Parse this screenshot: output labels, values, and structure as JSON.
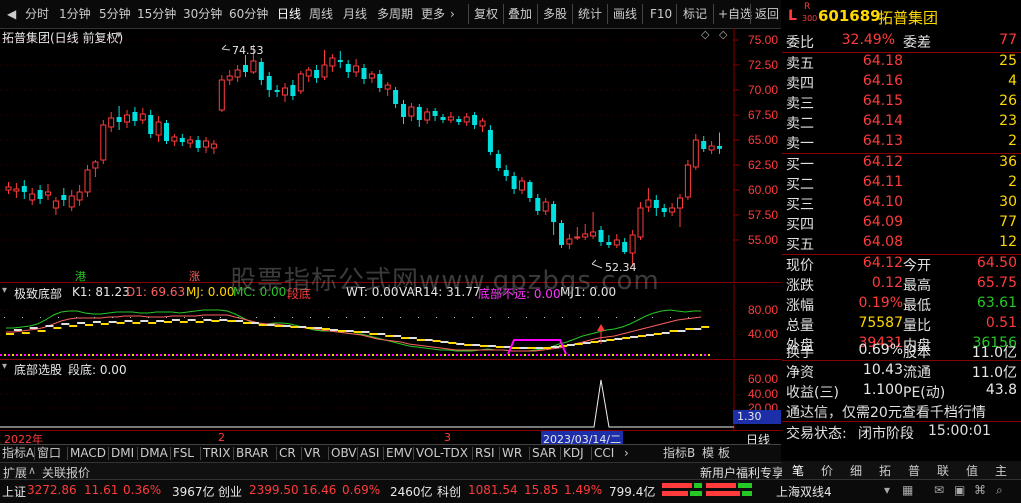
{
  "toolbar": {
    "items": [
      "分时",
      "1分钟",
      "5分钟",
      "15分钟",
      "30分钟",
      "60分钟",
      "日线",
      "周线",
      "月线",
      "多周期",
      "更多",
      "复权",
      "叠加",
      "多股",
      "统计",
      "画线",
      "F10",
      "标记",
      "+自选",
      "返回"
    ],
    "selected": "日线"
  },
  "stock": {
    "prefix": "L",
    "badge_r": "R",
    "badge_num": "300",
    "code": "601689",
    "name": "拓普集团"
  },
  "main_chart": {
    "title": "拓普集团(日线 前复权)",
    "marker_high": "74.53",
    "marker_low": "52.34",
    "marks": {
      "gang": "港",
      "zhang": "涨"
    },
    "y_ticks": [
      "75.00",
      "72.50",
      "70.00",
      "67.50",
      "65.00",
      "62.50",
      "60.00",
      "57.50",
      "55.00"
    ]
  },
  "sub1": {
    "name": "极致底部",
    "k1": "K1: 81.23",
    "d1": "D1: 69.63",
    "mj": "MJ: 0.00",
    "mc": "MC: 0.00",
    "duandi": "段底",
    "wt": "WT: 0.00",
    "var14": "VAR14: 31.77",
    "dibu": "底部不远: 0.00",
    "mj1": "MJ1: 0.00",
    "y_ticks": [
      "80.00",
      "40.00"
    ]
  },
  "sub2": {
    "name": "底部选股",
    "duandi": "段底: 0.00",
    "y_ticks": [
      "60.00",
      "40.00",
      "20.00"
    ],
    "cursor_value": "1.30"
  },
  "dates": {
    "year": "2022年",
    "m2": "2",
    "m3": "3",
    "cursor_date": "2023/03/14/二",
    "period": "日线"
  },
  "quote": {
    "weibi_label": "委比",
    "weibi": "32.49%",
    "weicha_label": "委差",
    "weicha": "77",
    "asks": [
      {
        "label": "卖五",
        "price": "64.18",
        "vol": "25"
      },
      {
        "label": "卖四",
        "price": "64.16",
        "vol": "4"
      },
      {
        "label": "卖三",
        "price": "64.15",
        "vol": "26"
      },
      {
        "label": "卖二",
        "price": "64.14",
        "vol": "23"
      },
      {
        "label": "卖一",
        "price": "64.13",
        "vol": "2"
      }
    ],
    "bids": [
      {
        "label": "买一",
        "price": "64.12",
        "vol": "36"
      },
      {
        "label": "买二",
        "price": "64.11",
        "vol": "2"
      },
      {
        "label": "买三",
        "price": "64.10",
        "vol": "30"
      },
      {
        "label": "买四",
        "price": "64.09",
        "vol": "77"
      },
      {
        "label": "买五",
        "price": "64.08",
        "vol": "12"
      }
    ],
    "stats": [
      {
        "l1": "现价",
        "v1": "64.12",
        "l2": "今开",
        "v2": "64.50"
      },
      {
        "l1": "涨跌",
        "v1": "0.12",
        "l2": "最高",
        "v2": "65.75"
      },
      {
        "l1": "涨幅",
        "v1": "0.19%",
        "l2": "最低",
        "v2": "63.61"
      },
      {
        "l1": "总量",
        "v1": "75587",
        "l2": "量比",
        "v2": "0.51"
      },
      {
        "l1": "外盘",
        "v1": "39431",
        "l2": "内盘",
        "v2": "36156"
      }
    ],
    "stats2": [
      {
        "l1": "换手",
        "v1": "0.69%",
        "l2": "股本",
        "v2": "11.0亿"
      },
      {
        "l1": "净资",
        "v1": "10.43",
        "l2": "流通",
        "v2": "11.0亿"
      },
      {
        "l1": "收益(三)",
        "v1": "1.100",
        "l2": "PE(动)",
        "v2": "43.8"
      }
    ],
    "ad_text": "通达信，仅需20元查看千档行情",
    "trade_status_label": "交易状态:",
    "trade_status": "闭市阶段",
    "trade_time": "15:00:01"
  },
  "tabs": [
    "指标A",
    "窗口",
    "MACD",
    "DMI",
    "DMA",
    "FSL",
    "TRIX",
    "BRAR",
    "CR",
    "VR",
    "OBV",
    "ASI",
    "EMV",
    "VOL-TDX",
    "RSI",
    "WR",
    "SAR",
    "KDJ",
    "CCI"
  ],
  "tab_right": [
    "指标B",
    "模",
    "板"
  ],
  "status_left": [
    "扩展",
    "关联报价"
  ],
  "status_right": "新用户福利专享",
  "right_buttons": [
    "笔",
    "价",
    "细",
    "拓",
    "普",
    "联",
    "值",
    "主"
  ],
  "bottom": {
    "sh_label": "上证",
    "sh_val": "3272.86",
    "sh_chg": "11.61",
    "sh_pct": "0.36%",
    "sh_amt": "3967亿",
    "cy_label": "创业",
    "cy_val": "2399.50",
    "cy_chg": "16.46",
    "cy_pct": "0.69%",
    "cy_amt": "2460亿",
    "kc_label": "科创",
    "kc_val": "1081.54",
    "kc_chg": "15.85",
    "kc_pct": "1.49%",
    "kc_amt": "799.4亿",
    "line_label": "上海双线4"
  },
  "watermark": "股票指标公式网www.gpzbgs.com",
  "colors": {
    "up": "#ff3b3b",
    "down": "#00e0e0",
    "yellow": "#ffd800",
    "green": "#26c826",
    "magenta": "#ff00ff"
  }
}
